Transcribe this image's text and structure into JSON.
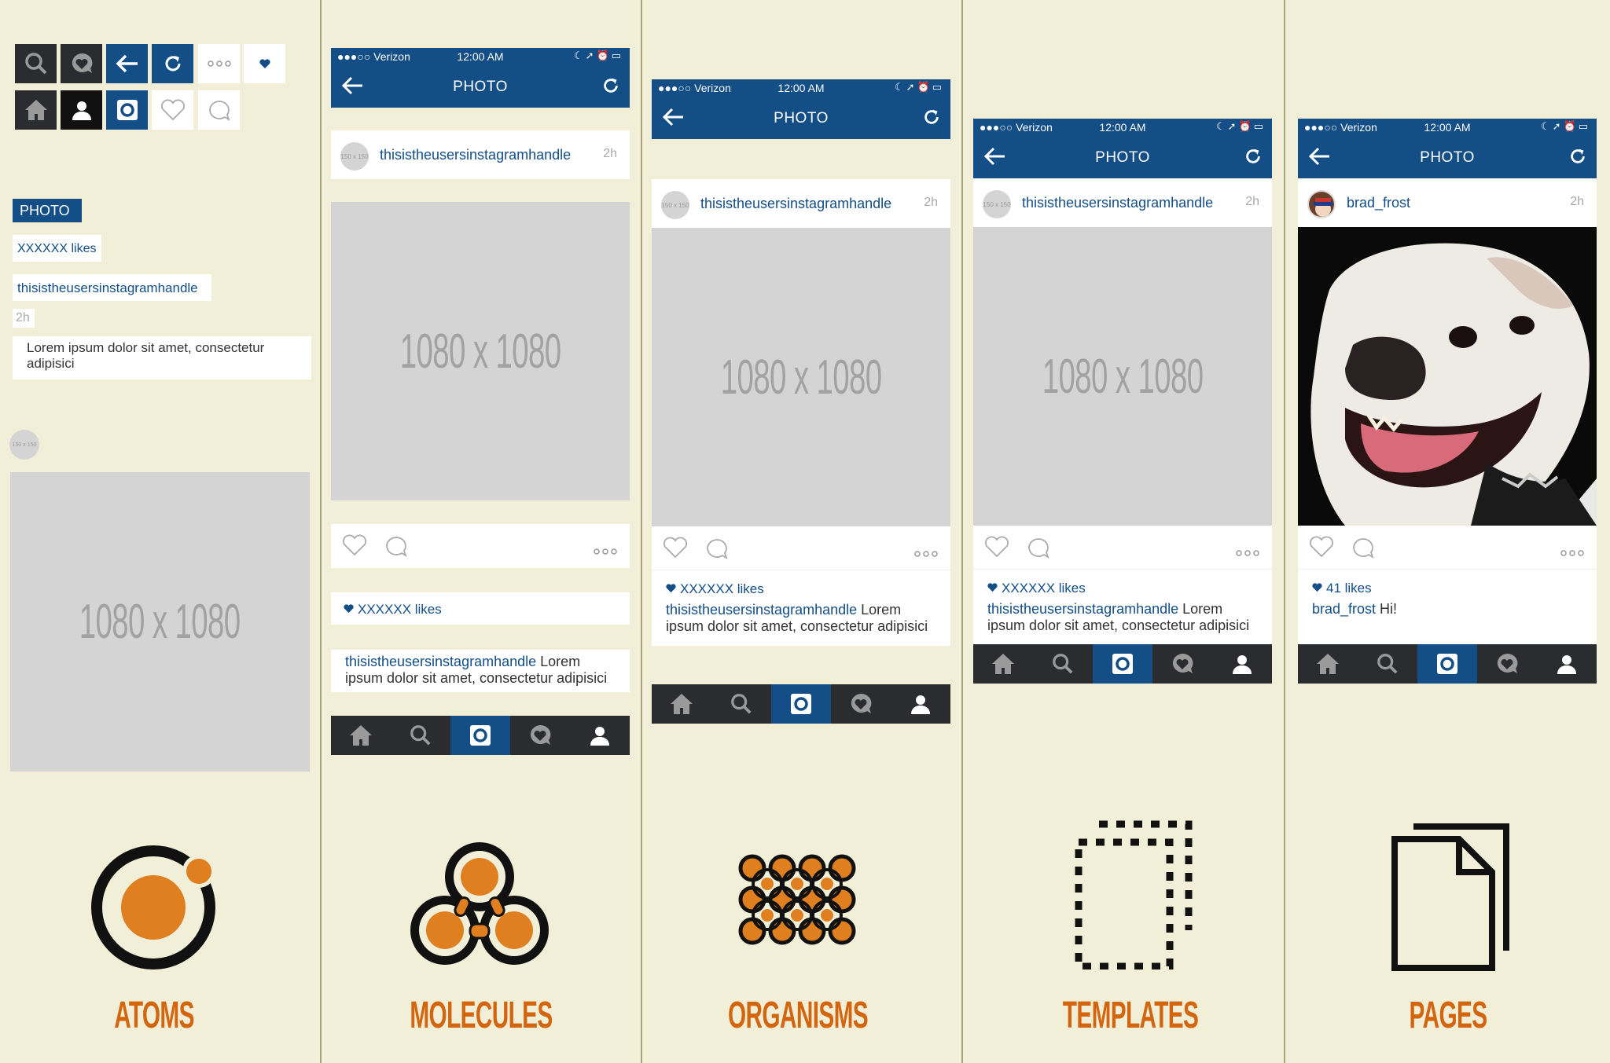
{
  "atoms": {
    "photo_label": "PHOTO",
    "likes_text": "XXXXXX likes",
    "handle_text": "thisistheusersinstagramhandle",
    "time_text": "2h",
    "caption_text": "Lorem ipsum dolor sit amet, consectetur adipisici",
    "avatar_text": "150 x 150",
    "placeholder_text": "1080 x 1080"
  },
  "molecules": {
    "status": {
      "carrier": "●●●○○ Verizon",
      "time": "12:00 AM"
    },
    "title": "PHOTO",
    "avatar_text": "150 x 150",
    "handle": "thisistheusersinstagramhandle",
    "time": "2h",
    "placeholder_text": "1080 x 1080",
    "likes": "XXXXXX likes",
    "caption_handle": "thisistheusersinstagramhandle",
    "caption_text": " Lorem ipsum dolor sit amet, consectetur adipisici"
  },
  "organisms": {
    "status": {
      "carrier": "●●●○○ Verizon",
      "time": "12:00 AM"
    },
    "title": "PHOTO",
    "avatar_text": "150 x 150",
    "handle": "thisistheusersinstagramhandle",
    "time": "2h",
    "placeholder_text": "1080 x 1080",
    "likes": "XXXXXX likes",
    "caption_handle": "thisistheusersinstagramhandle",
    "caption_text": " Lorem ipsum dolor sit amet, consectetur adipisici"
  },
  "templates": {
    "status": {
      "carrier": "●●●○○ Verizon",
      "time": "12:00 AM"
    },
    "title": "PHOTO",
    "avatar_text": "150 x 150",
    "handle": "thisistheusersinstagramhandle",
    "time": "2h",
    "placeholder_text": "1080 x 1080",
    "likes": "XXXXXX likes",
    "caption_handle": "thisistheusersinstagramhandle",
    "caption_text": " Lorem ipsum dolor sit amet, consectetur adipisici"
  },
  "pages": {
    "status": {
      "carrier": "●●●○○ Verizon",
      "time": "12:00 AM"
    },
    "title": "PHOTO",
    "handle": "brad_frost",
    "time": "2h",
    "likes": "41 likes",
    "caption_handle": "brad_frost",
    "caption_text": " Hi!"
  },
  "labels": {
    "atoms": "ATOMS",
    "molecules": "MOLECULES",
    "organisms": "ORGANISMS",
    "templates": "TEMPLATES",
    "pages": "PAGES"
  },
  "colors": {
    "brand_blue": "#134e86",
    "dark": "#2a2c30",
    "orange": "#e07f1f",
    "label_orange": "#d3650e",
    "background": "#f2efd8"
  }
}
